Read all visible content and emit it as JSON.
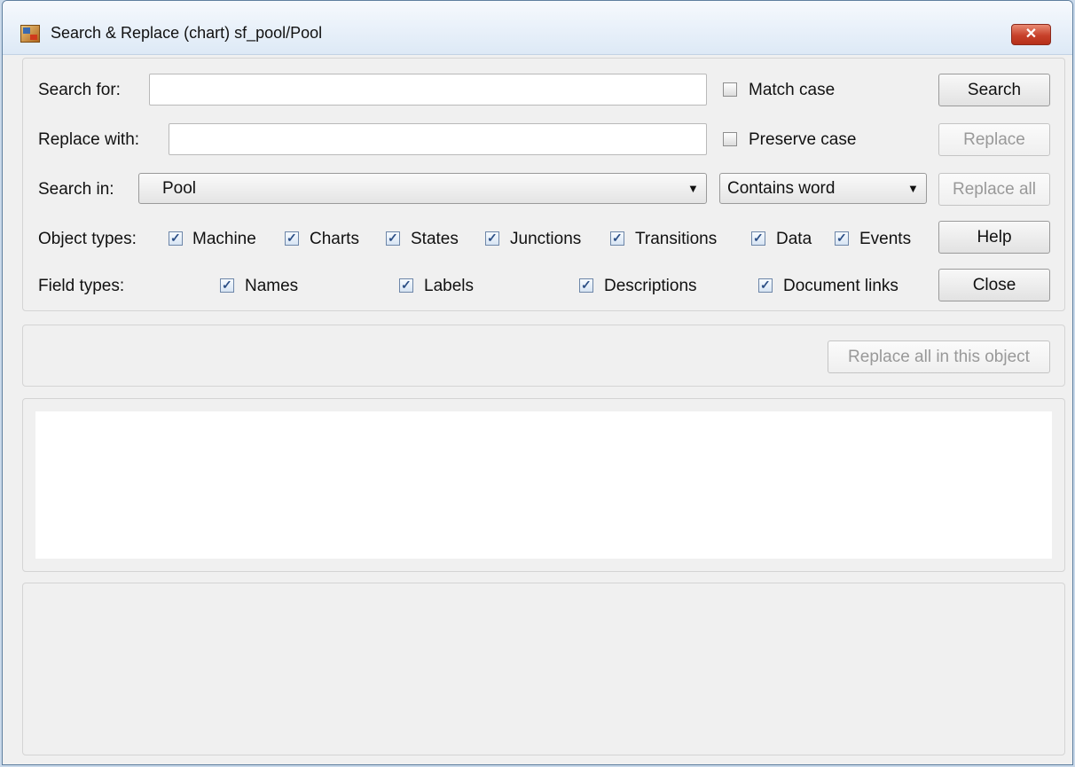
{
  "window": {
    "title": "Search & Replace (chart) sf_pool/Pool",
    "close_glyph": "✕"
  },
  "search": {
    "search_for_label": "Search for:",
    "search_for_value": "",
    "replace_with_label": "Replace with:",
    "replace_with_value": "",
    "search_in_label": "Search in:",
    "search_in_value": "Pool",
    "match_mode_value": "Contains word",
    "match_case_label": "Match case",
    "match_case_checked": false,
    "preserve_case_label": "Preserve case",
    "preserve_case_checked": false
  },
  "object_types": {
    "label": "Object types:",
    "items": [
      {
        "label": "Machine",
        "checked": true
      },
      {
        "label": "Charts",
        "checked": true
      },
      {
        "label": "States",
        "checked": true
      },
      {
        "label": "Junctions",
        "checked": true
      },
      {
        "label": "Transitions",
        "checked": true
      },
      {
        "label": "Data",
        "checked": true
      },
      {
        "label": "Events",
        "checked": true
      }
    ]
  },
  "field_types": {
    "label": "Field types:",
    "items": [
      {
        "label": "Names",
        "checked": true
      },
      {
        "label": "Labels",
        "checked": true
      },
      {
        "label": "Descriptions",
        "checked": true
      },
      {
        "label": "Document links",
        "checked": true
      }
    ]
  },
  "buttons": {
    "search": "Search",
    "replace": "Replace",
    "replace_all": "Replace all",
    "help": "Help",
    "close": "Close",
    "replace_all_in_object": "Replace all in this object"
  },
  "icons": {
    "dropdown": "▼",
    "check": "✓"
  },
  "colors": {
    "title_bar": "#dde9f6",
    "close_button": "#c7412a",
    "check_accent": "#2c4f86"
  }
}
